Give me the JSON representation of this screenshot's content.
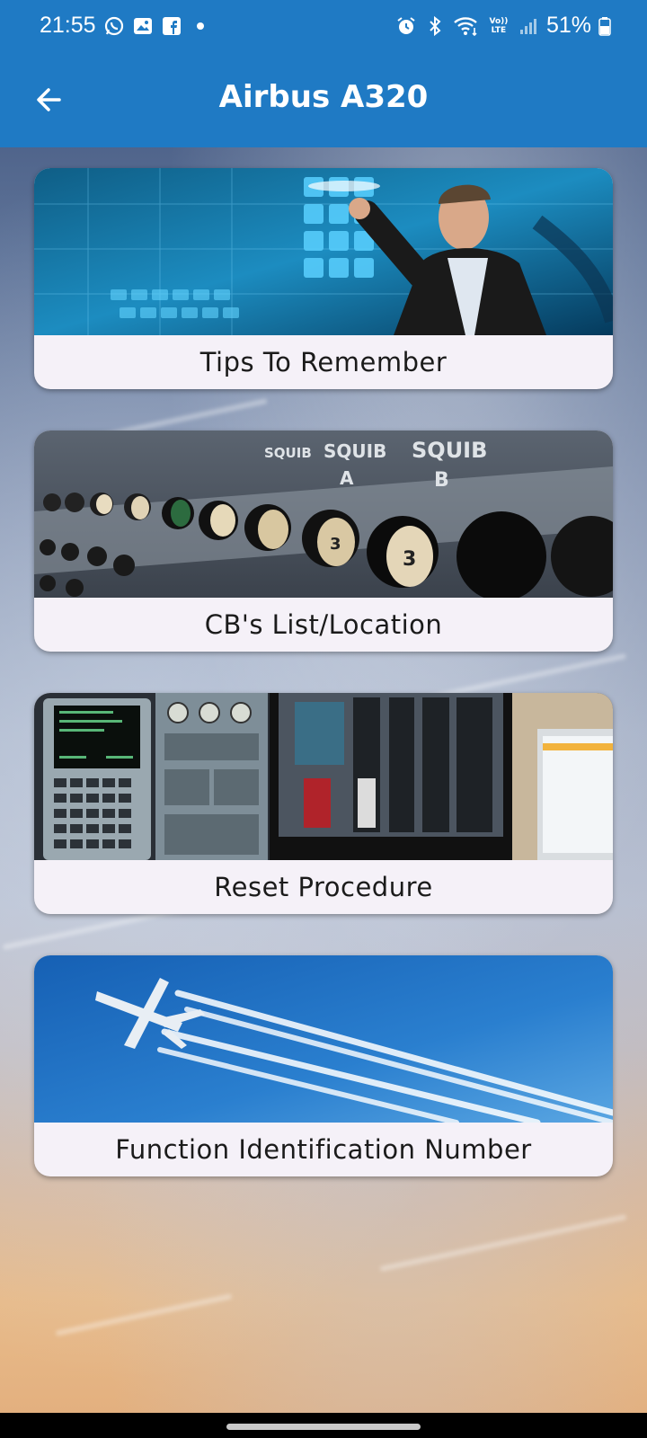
{
  "status_bar": {
    "time": "21:55",
    "battery": "51%",
    "left_icons": [
      "whatsapp-icon",
      "gallery-icon",
      "facebook-icon",
      "dot-icon"
    ],
    "right_icons": [
      "alarm-icon",
      "bluetooth-icon",
      "wifi-icon",
      "volte-icon",
      "signal-icon",
      "battery-icon"
    ],
    "volte_text": "Vo)) LTE"
  },
  "app_bar": {
    "title": "Airbus A320",
    "color": "#1f7ac4"
  },
  "cards": [
    {
      "label": "Tips To Remember",
      "image": "touchscreen-interface-image"
    },
    {
      "label": "CB's List/Location",
      "image": "circuit-breaker-panel-image",
      "panel_labels": [
        "SQUIB",
        "SQUIB",
        "A",
        "B",
        "3",
        "3"
      ]
    },
    {
      "label": "Reset Procedure",
      "image": "avionics-mcdu-image"
    },
    {
      "label": "Function Identification Number",
      "image": "airplane-contrails-image"
    }
  ]
}
